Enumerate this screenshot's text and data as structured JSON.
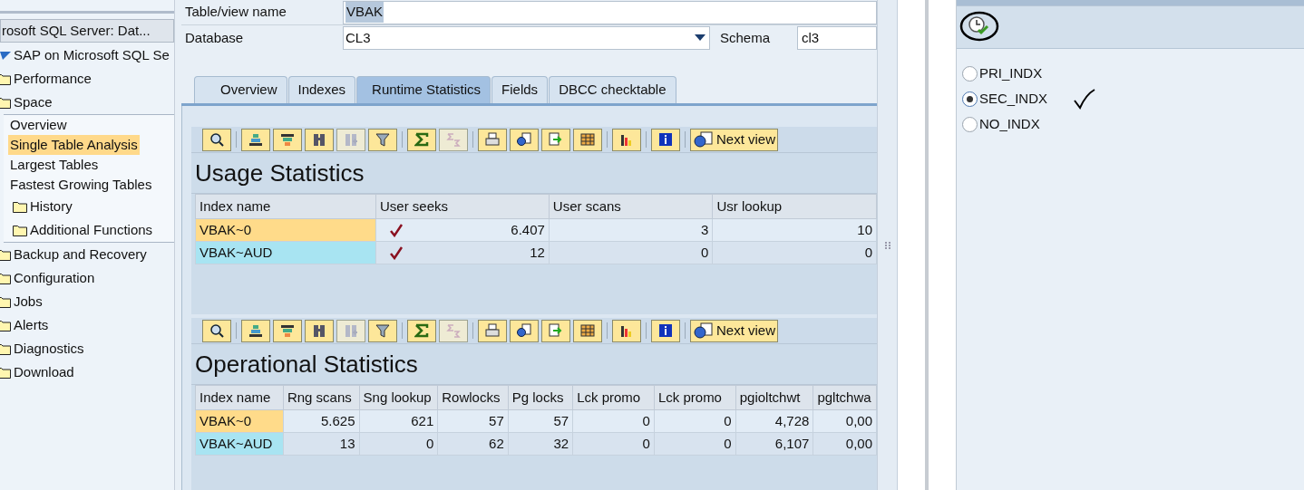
{
  "sidebar": {
    "header": "rosoft SQL Server: Dat...",
    "tree": [
      {
        "label": "SAP on Microsoft SQL Se",
        "kind": "root",
        "expanded": true,
        "children": [
          {
            "label": "Performance",
            "kind": "folder",
            "expanded": false
          },
          {
            "label": "Space",
            "kind": "folder",
            "expanded": true,
            "children": [
              {
                "label": "Overview",
                "kind": "leaf",
                "selected": false
              },
              {
                "label": "Single Table Analysis",
                "kind": "leaf",
                "selected": true
              },
              {
                "label": "Largest Tables",
                "kind": "leaf",
                "selected": false
              },
              {
                "label": "Fastest Growing Tables",
                "kind": "leaf",
                "selected": false
              },
              {
                "label": "History",
                "kind": "folder",
                "expanded": false
              },
              {
                "label": "Additional Functions",
                "kind": "folder",
                "expanded": false
              }
            ]
          },
          {
            "label": "Backup and Recovery",
            "kind": "folder",
            "expanded": false
          },
          {
            "label": "Configuration",
            "kind": "folder",
            "expanded": false
          },
          {
            "label": "Jobs",
            "kind": "folder",
            "expanded": false
          },
          {
            "label": "Alerts",
            "kind": "folder",
            "expanded": false
          },
          {
            "label": "Diagnostics",
            "kind": "folder",
            "expanded": false
          },
          {
            "label": "Download",
            "kind": "folder",
            "expanded": false
          }
        ]
      }
    ]
  },
  "form": {
    "table_label": "Table/view name",
    "table_value": "VBAK",
    "database_label": "Database",
    "database_value": "CL3",
    "schema_label": "Schema",
    "schema_value": "cl3"
  },
  "tabs": [
    {
      "label": "Overview",
      "selected": false
    },
    {
      "label": "Indexes",
      "selected": false
    },
    {
      "label": "Runtime Statistics",
      "selected": true
    },
    {
      "label": "Fields",
      "selected": false
    },
    {
      "label": "DBCC checktable",
      "selected": false
    }
  ],
  "sections": [
    {
      "title": "Usage Statistics",
      "next_view": "Next view",
      "columns": [
        "Index name",
        "User seeks",
        "User scans",
        "Usr lookup"
      ],
      "rows": [
        {
          "color": "#ffdb8a",
          "cells": [
            {
              "text": "VBAK~0"
            },
            {
              "text": "6.407",
              "checked": true
            },
            {
              "text": "3",
              "checked": false
            },
            {
              "text": "10",
              "checked": false
            }
          ]
        },
        {
          "color": "#a8e4f2",
          "cells": [
            {
              "text": "VBAK~AUD"
            },
            {
              "text": "12",
              "checked": true
            },
            {
              "text": "0",
              "checked": false
            },
            {
              "text": "0",
              "checked": false
            }
          ]
        }
      ]
    },
    {
      "title": "Operational Statistics",
      "next_view": "Next view",
      "columns": [
        "Index name",
        "Rng scans",
        "Sng lookup",
        "Rowlocks",
        "Pg locks",
        "Lck promo",
        "Lck promo",
        "pgioltchwt",
        "pgltchwa"
      ],
      "rows": [
        {
          "color": "#ffdb8a",
          "cells": [
            {
              "text": "VBAK~0"
            },
            {
              "text": "5.625",
              "checked": false
            },
            {
              "text": "621",
              "checked": false
            },
            {
              "text": "57",
              "checked": false
            },
            {
              "text": "57",
              "checked": false
            },
            {
              "text": "0",
              "checked": false
            },
            {
              "text": "0",
              "checked": false
            },
            {
              "text": "4,728",
              "checked": false
            },
            {
              "text": "0,00",
              "checked": false
            }
          ]
        },
        {
          "color": "#a8e4f2",
          "cells": [
            {
              "text": "VBAK~AUD"
            },
            {
              "text": "13",
              "checked": false
            },
            {
              "text": "0",
              "checked": false
            },
            {
              "text": "62",
              "checked": false
            },
            {
              "text": "32",
              "checked": false
            },
            {
              "text": "0",
              "checked": false
            },
            {
              "text": "0",
              "checked": false
            },
            {
              "text": "6,107",
              "checked": false
            },
            {
              "text": "0,00",
              "checked": false
            }
          ]
        }
      ]
    }
  ],
  "radio_options": [
    {
      "label": "PRI_INDX",
      "selected": false
    },
    {
      "label": "SEC_INDX",
      "selected": true
    },
    {
      "label": "NO_INDX",
      "selected": false
    }
  ]
}
